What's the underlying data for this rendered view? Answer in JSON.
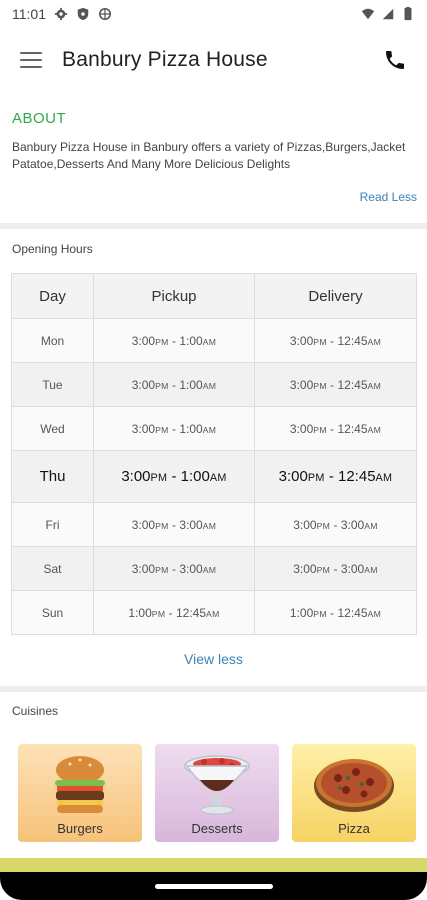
{
  "status_bar": {
    "time": "11:01"
  },
  "app_bar": {
    "title": "Banbury Pizza House"
  },
  "about": {
    "heading": "ABOUT",
    "text": "Banbury Pizza House in Banbury offers a variety of Pizzas,Burgers,Jacket Patatoe,Desserts And Many More Delicious Delights",
    "read_less": "Read Less"
  },
  "opening_hours": {
    "label": "Opening Hours",
    "columns": [
      "Day",
      "Pickup",
      "Delivery"
    ],
    "rows": [
      {
        "day": "Mon",
        "pickup_open": "3:00",
        "pickup_open_ampm": "PM",
        "pickup_close": "1:00",
        "pickup_close_ampm": "AM",
        "delivery_open": "3:00",
        "delivery_open_ampm": "PM",
        "delivery_close": "12:45",
        "delivery_close_ampm": "AM"
      },
      {
        "day": "Tue",
        "pickup_open": "3:00",
        "pickup_open_ampm": "PM",
        "pickup_close": "1:00",
        "pickup_close_ampm": "AM",
        "delivery_open": "3:00",
        "delivery_open_ampm": "PM",
        "delivery_close": "12:45",
        "delivery_close_ampm": "AM"
      },
      {
        "day": "Wed",
        "pickup_open": "3:00",
        "pickup_open_ampm": "PM",
        "pickup_close": "1:00",
        "pickup_close_ampm": "AM",
        "delivery_open": "3:00",
        "delivery_open_ampm": "PM",
        "delivery_close": "12:45",
        "delivery_close_ampm": "AM"
      },
      {
        "day": "Thu",
        "pickup_open": "3:00",
        "pickup_open_ampm": "PM",
        "pickup_close": "1:00",
        "pickup_close_ampm": "AM",
        "delivery_open": "3:00",
        "delivery_open_ampm": "PM",
        "delivery_close": "12:45",
        "delivery_close_ampm": "AM"
      },
      {
        "day": "Fri",
        "pickup_open": "3:00",
        "pickup_open_ampm": "PM",
        "pickup_close": "3:00",
        "pickup_close_ampm": "AM",
        "delivery_open": "3:00",
        "delivery_open_ampm": "PM",
        "delivery_close": "3:00",
        "delivery_close_ampm": "AM"
      },
      {
        "day": "Sat",
        "pickup_open": "3:00",
        "pickup_open_ampm": "PM",
        "pickup_close": "3:00",
        "pickup_close_ampm": "AM",
        "delivery_open": "3:00",
        "delivery_open_ampm": "PM",
        "delivery_close": "3:00",
        "delivery_close_ampm": "AM"
      },
      {
        "day": "Sun",
        "pickup_open": "1:00",
        "pickup_open_ampm": "PM",
        "pickup_close": "12:45",
        "pickup_close_ampm": "AM",
        "delivery_open": "1:00",
        "delivery_open_ampm": "PM",
        "delivery_close": "12:45",
        "delivery_close_ampm": "AM"
      }
    ],
    "view_less": "View less"
  },
  "cuisines": {
    "label": "Cuisines",
    "items": [
      {
        "label": "Burgers",
        "image": "burger-image"
      },
      {
        "label": "Desserts",
        "image": "dessert-image"
      },
      {
        "label": "Pizza",
        "image": "pizza-image"
      }
    ]
  },
  "colors": {
    "accent_green": "#2eaa4a",
    "link_blue": "#3b82b8",
    "bottom_strip": "#d8d86a"
  }
}
